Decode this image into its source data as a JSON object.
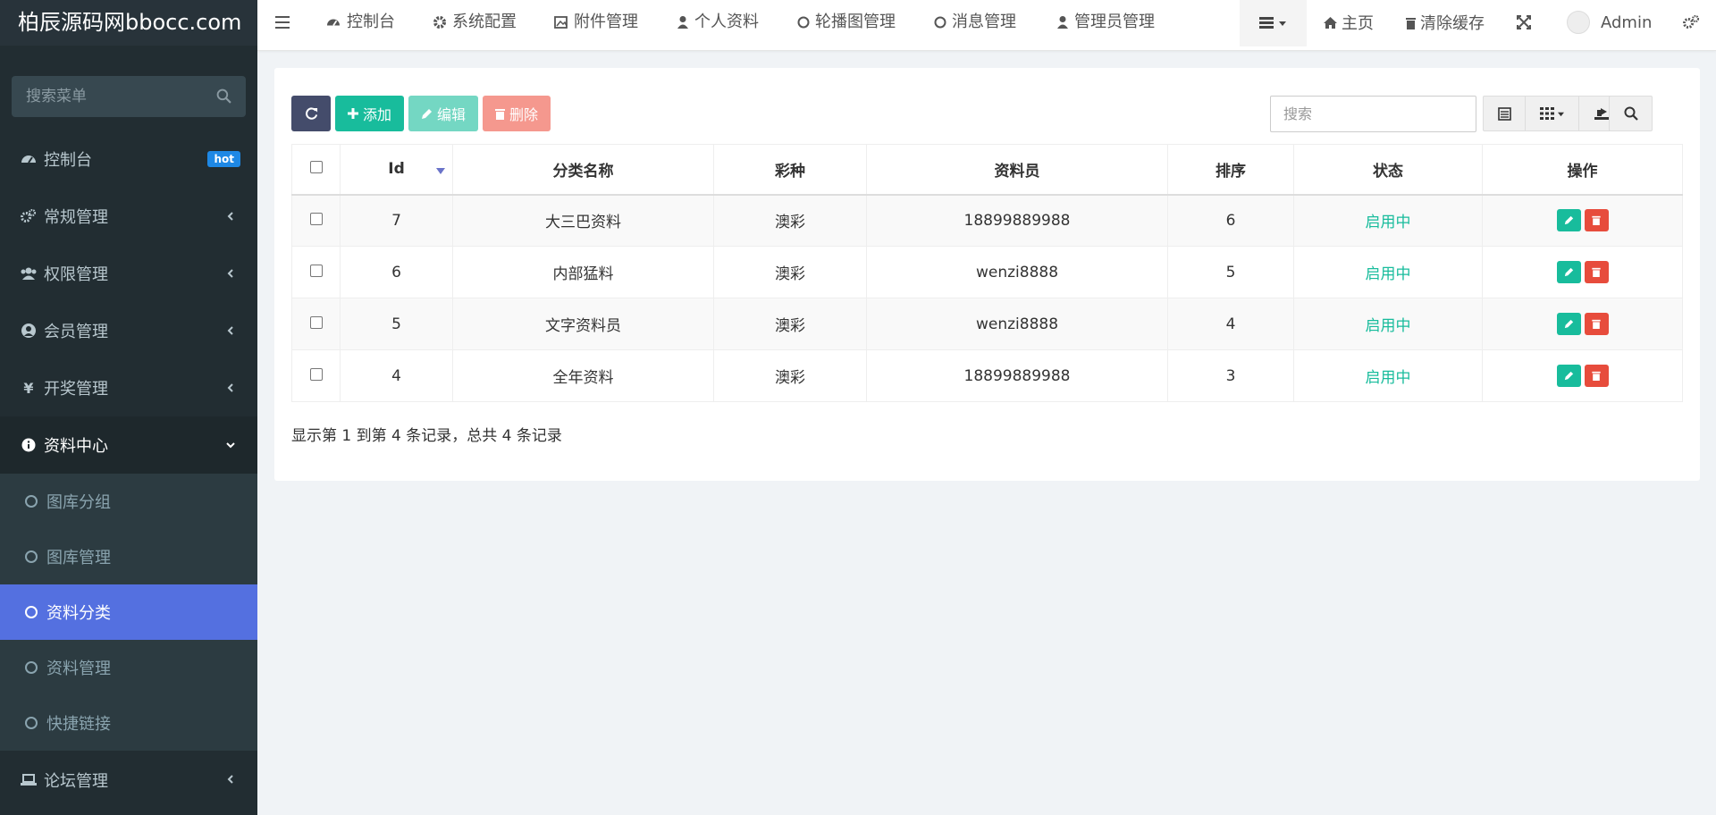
{
  "app": {
    "logo": "柏辰源码网bbocc.com"
  },
  "sidebar": {
    "search_placeholder": "搜索菜单",
    "items": [
      {
        "label": "控制台",
        "badge": "hot"
      },
      {
        "label": "常规管理"
      },
      {
        "label": "权限管理"
      },
      {
        "label": "会员管理"
      },
      {
        "label": "开奖管理"
      },
      {
        "label": "资料中心"
      },
      {
        "label": "论坛管理"
      }
    ],
    "submenu": [
      {
        "label": "图库分组"
      },
      {
        "label": "图库管理"
      },
      {
        "label": "资料分类"
      },
      {
        "label": "资料管理"
      },
      {
        "label": "快捷链接"
      }
    ]
  },
  "topbar": {
    "tabs": [
      {
        "label": "控制台"
      },
      {
        "label": "系统配置"
      },
      {
        "label": "附件管理"
      },
      {
        "label": "个人资料"
      },
      {
        "label": "轮播图管理"
      },
      {
        "label": "消息管理"
      },
      {
        "label": "管理员管理"
      }
    ],
    "home": "主页",
    "clear_cache": "清除缓存",
    "user": "Admin"
  },
  "toolbar": {
    "add": "添加",
    "edit": "编辑",
    "delete": "删除",
    "search_placeholder": "搜索"
  },
  "table": {
    "columns": [
      "Id",
      "分类名称",
      "彩种",
      "资料员",
      "排序",
      "状态",
      "操作"
    ],
    "rows": [
      {
        "id": "7",
        "name": "大三巴资料",
        "type": "澳彩",
        "clerk": "18899889988",
        "order": "6",
        "status": "启用中"
      },
      {
        "id": "6",
        "name": "内部猛料",
        "type": "澳彩",
        "clerk": "wenzi8888",
        "order": "5",
        "status": "启用中"
      },
      {
        "id": "5",
        "name": "文字资料员",
        "type": "澳彩",
        "clerk": "wenzi8888",
        "order": "4",
        "status": "启用中"
      },
      {
        "id": "4",
        "name": "全年资料",
        "type": "澳彩",
        "clerk": "18899889988",
        "order": "3",
        "status": "启用中"
      }
    ],
    "summary": "显示第 1 到第 4 条记录，总共 4 条记录"
  },
  "colors": {
    "sidebar_bg": "#222d32",
    "active_item": "#5470e0",
    "success": "#18bc9c",
    "danger": "#e74c3c",
    "badge": "#1e88e5"
  }
}
